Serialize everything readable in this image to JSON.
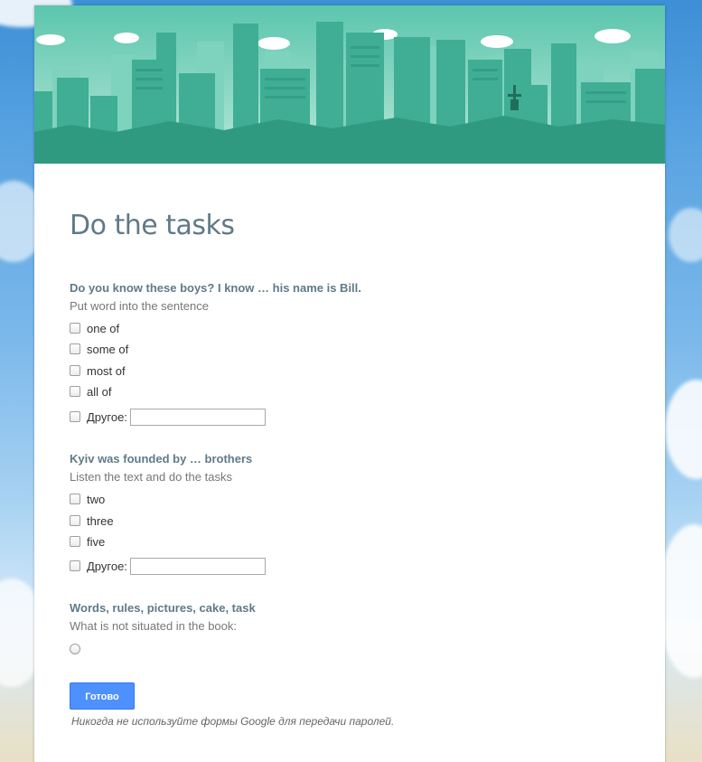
{
  "form": {
    "title": "Do the tasks",
    "accent_color": "#5f7a88",
    "header_theme": "teal-city-skyline"
  },
  "questions": [
    {
      "title": "Do you know these boys? I know … his name is Bill.",
      "help": "Put word into the sentence",
      "type": "checkbox",
      "options": [
        "one of",
        "some of",
        "most of",
        "all of"
      ],
      "other_label": "Другое:",
      "other_value": ""
    },
    {
      "title": "Kyiv was founded by … brothers",
      "help": "Listen the text and do the tasks",
      "type": "checkbox",
      "options": [
        "two",
        "three",
        "five"
      ],
      "other_label": "Другое:",
      "other_value": ""
    },
    {
      "title": "Words, rules, pictures, cake, task",
      "help": "What is not situated in the book:",
      "type": "radio",
      "options": [
        ""
      ]
    }
  ],
  "submit": {
    "label": "Готово",
    "color": "#4d90fe"
  },
  "footer": {
    "password_warning": "Никогда не используйте формы Google для передачи паролей."
  }
}
